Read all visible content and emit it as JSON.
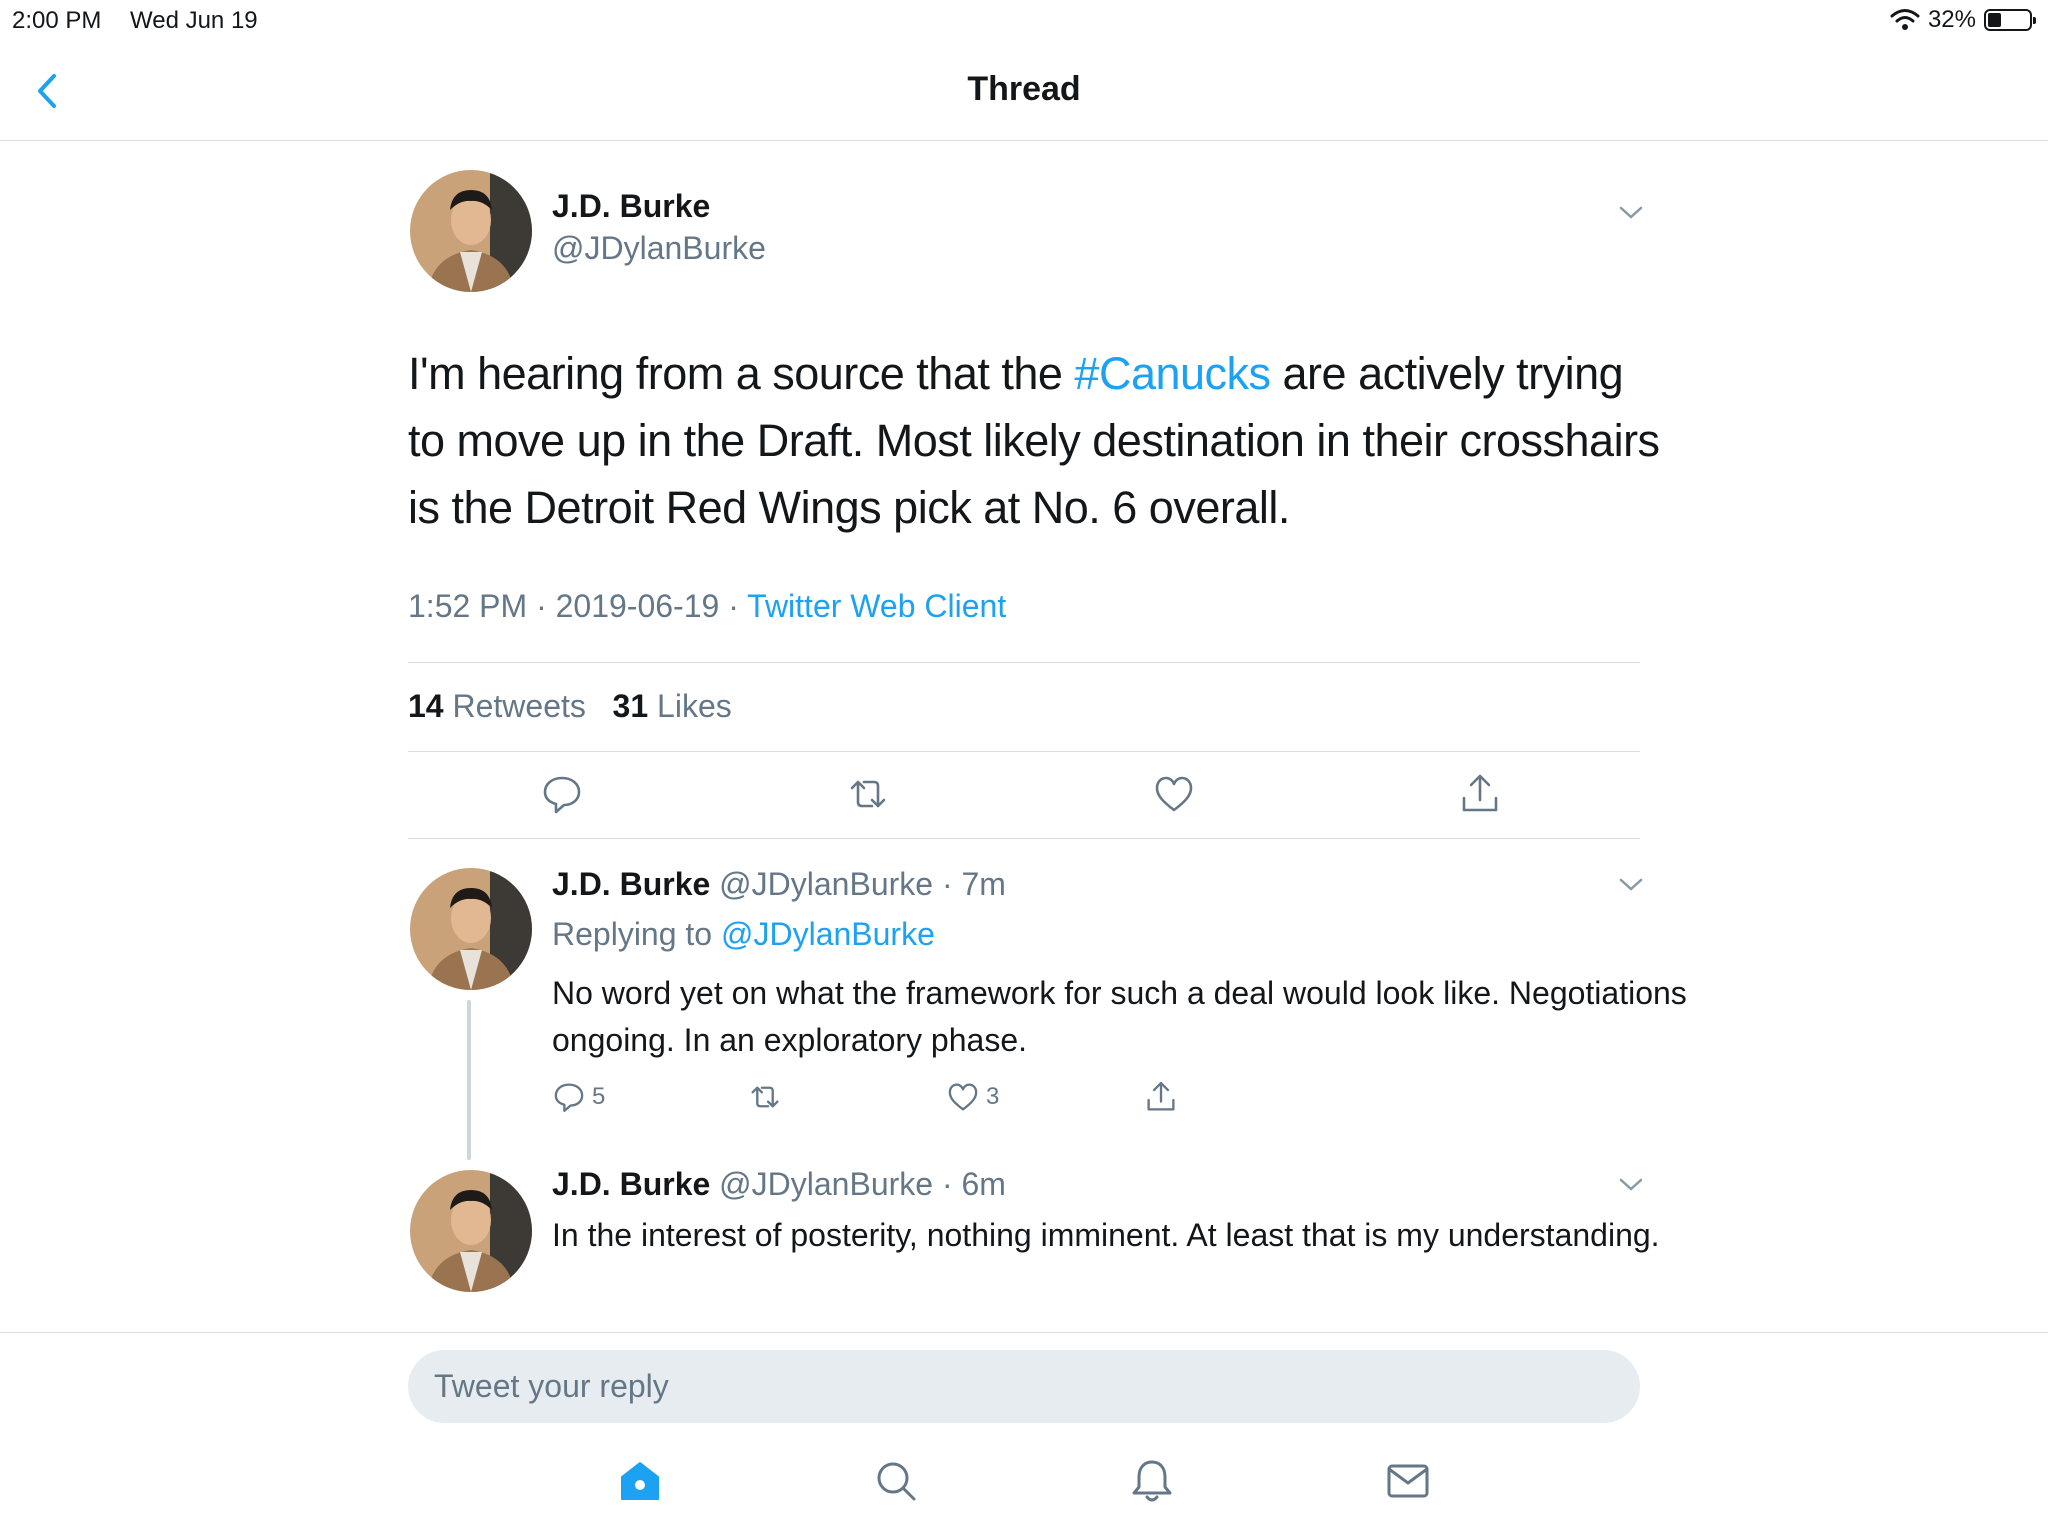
{
  "status_bar": {
    "time": "2:00 PM",
    "date": "Wed Jun 19",
    "battery": "32%",
    "battery_level": 0.32
  },
  "nav": {
    "title": "Thread"
  },
  "main_tweet": {
    "author_name": "J.D. Burke",
    "author_handle": "@JDylanBurke",
    "text_before": "I'm hearing from a source that the ",
    "hashtag": "#Canucks",
    "text_after": " are actively trying to move up in the Draft. Most likely destination in their crosshairs is the Detroit Red Wings pick at No. 6 overall.",
    "time": "1:52 PM",
    "date": "2019-06-19",
    "separator": "·",
    "source": "Twitter Web Client",
    "retweets_count": "14",
    "retweets_label": "Retweets",
    "likes_count": "31",
    "likes_label": "Likes"
  },
  "replies": [
    {
      "author_name": "J.D. Burke",
      "author_handle": "@JDylanBurke",
      "age": "7m",
      "replying_prefix": "Replying to ",
      "replying_to": "@JDylanBurke",
      "text": "No word yet on what the framework for such a deal would look like. Negotiations ongoing. In an exploratory phase.",
      "reply_count": "5",
      "retweet_count": "",
      "like_count": "3"
    },
    {
      "author_name": "J.D. Burke",
      "author_handle": "@JDylanBurke",
      "age": "6m",
      "text": "In the interest of posterity, nothing imminent. At least that is my understanding."
    }
  ],
  "compose": {
    "placeholder": "Tweet your reply"
  },
  "icons": {
    "back": "chevron-left-icon",
    "caret": "chevron-down-icon",
    "reply": "speech-bubble-icon",
    "retweet": "retweet-icon",
    "like": "heart-icon",
    "share": "share-icon",
    "tabs": [
      "home-icon",
      "search-icon",
      "bell-icon",
      "mail-icon"
    ]
  },
  "colors": {
    "accent": "#1da1f2",
    "secondary_text": "#657786",
    "divider": "#d7dde2",
    "input_bg": "#e6ecf0"
  }
}
